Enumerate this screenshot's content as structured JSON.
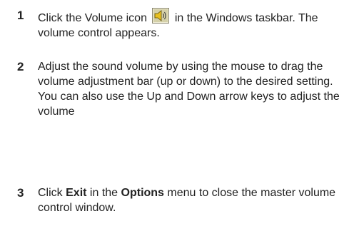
{
  "steps": [
    {
      "number": "1",
      "text_before_icon": "Click the Volume icon",
      "icon": "speaker-volume-icon",
      "text_after_icon": "in the Windows taskbar. The volume control appears."
    },
    {
      "number": "2",
      "text": "Adjust the sound volume by using the mouse to drag the volume adjustment bar (up or down) to the desired setting.  You can also use the Up and Down arrow keys to adjust the volume"
    },
    {
      "number": "3",
      "text_1": "Click",
      "bold_1": "Exit",
      "text_2": "in the",
      "bold_2": "Options",
      "text_3": "menu to close the master volume control window."
    }
  ]
}
